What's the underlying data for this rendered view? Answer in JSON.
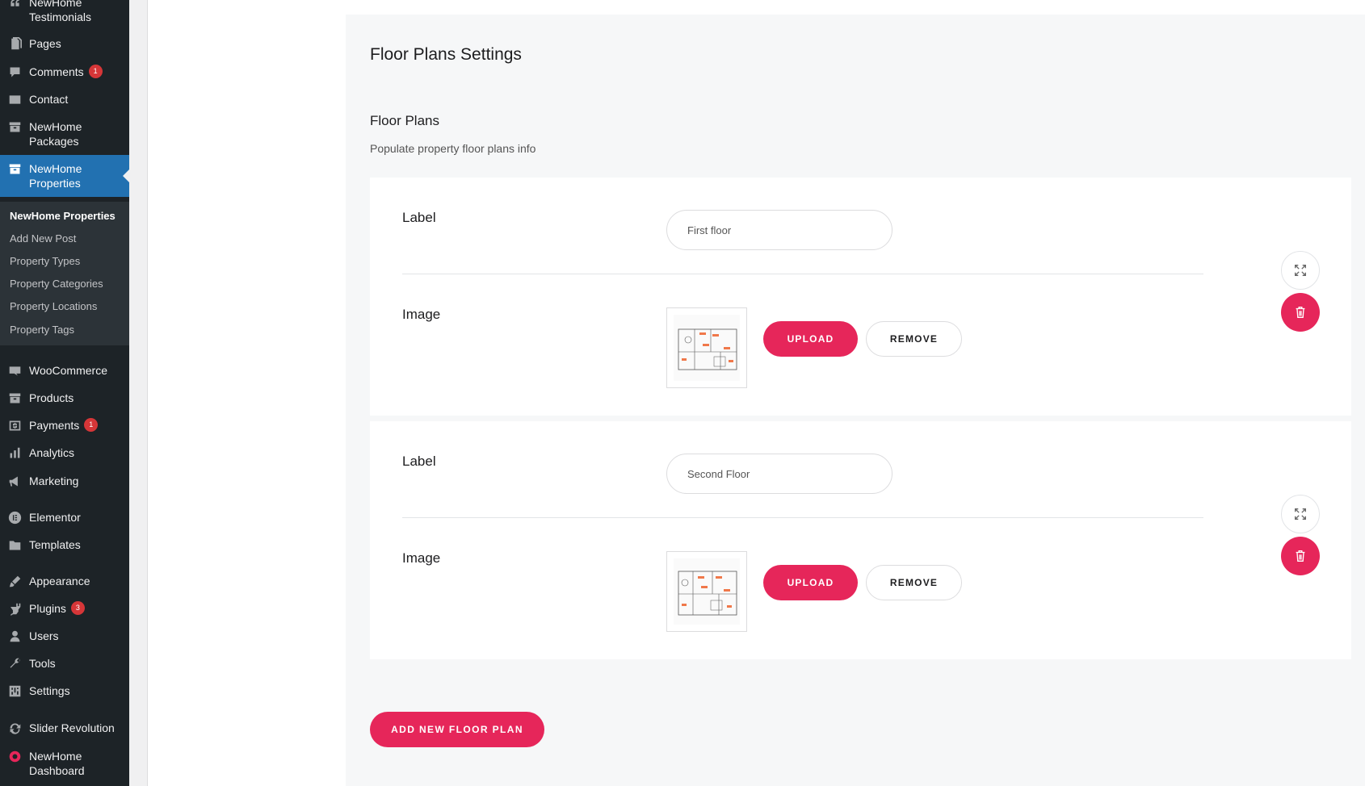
{
  "sidebar": {
    "items": [
      {
        "label": "NewHome Testimonials",
        "icon": "quote-icon"
      },
      {
        "label": "Pages",
        "icon": "page-icon"
      },
      {
        "label": "Comments",
        "icon": "comment-icon",
        "badge": "1"
      },
      {
        "label": "Contact",
        "icon": "mail-icon"
      },
      {
        "label": "NewHome Packages",
        "icon": "archive-icon"
      },
      {
        "label": "NewHome Properties",
        "icon": "archive-icon"
      },
      {
        "label": "WooCommerce",
        "icon": "woo-icon"
      },
      {
        "label": "Products",
        "icon": "archive-icon"
      },
      {
        "label": "Payments",
        "icon": "dollar-icon",
        "badge": "1"
      },
      {
        "label": "Analytics",
        "icon": "bar-chart-icon"
      },
      {
        "label": "Marketing",
        "icon": "megaphone-icon"
      },
      {
        "label": "Elementor",
        "icon": "elementor-icon"
      },
      {
        "label": "Templates",
        "icon": "folder-icon"
      },
      {
        "label": "Appearance",
        "icon": "brush-icon"
      },
      {
        "label": "Plugins",
        "icon": "plug-icon",
        "badge": "3"
      },
      {
        "label": "Users",
        "icon": "user-icon"
      },
      {
        "label": "Tools",
        "icon": "wrench-icon"
      },
      {
        "label": "Settings",
        "icon": "sliders-icon"
      },
      {
        "label": "Slider Revolution",
        "icon": "refresh-icon"
      },
      {
        "label": "NewHome Dashboard",
        "icon": "circle-icon"
      }
    ],
    "submenu": [
      {
        "label": "NewHome Properties"
      },
      {
        "label": "Add New Post"
      },
      {
        "label": "Property Types"
      },
      {
        "label": "Property Categories"
      },
      {
        "label": "Property Locations"
      },
      {
        "label": "Property Tags"
      }
    ]
  },
  "settings": {
    "title": "Floor Plans Settings",
    "section_title": "Floor Plans",
    "section_desc": "Populate property floor plans info",
    "plans": [
      {
        "label_field": "Label",
        "value": "First floor",
        "image_field": "Image"
      },
      {
        "label_field": "Label",
        "value": "Second Floor",
        "image_field": "Image"
      }
    ],
    "upload_label": "UPLOAD",
    "remove_label": "REMOVE",
    "add_label": "ADD NEW FLOOR PLAN"
  },
  "colors": {
    "accent": "#e6265a",
    "sidebar_bg": "#1d2327",
    "active": "#2271b1"
  }
}
